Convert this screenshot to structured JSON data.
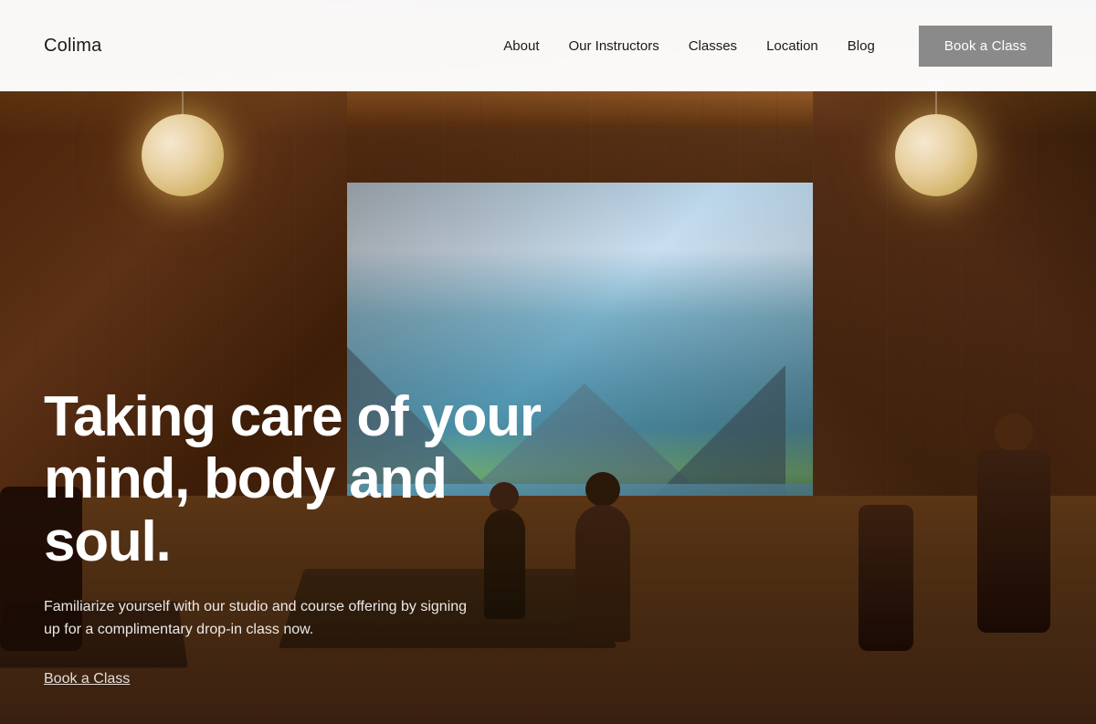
{
  "brand": {
    "logo": "Colima"
  },
  "navbar": {
    "links": [
      {
        "label": "About",
        "id": "about"
      },
      {
        "label": "Our Instructors",
        "id": "instructors"
      },
      {
        "label": "Classes",
        "id": "classes"
      },
      {
        "label": "Location",
        "id": "location"
      },
      {
        "label": "Blog",
        "id": "blog"
      }
    ],
    "cta_label": "Book a Class"
  },
  "hero": {
    "title": "Taking care of your mind, body and soul.",
    "subtitle": "Familiarize yourself with our studio and course offering by signing up for a complimentary drop-in class now.",
    "cta_label": "Book a Class"
  }
}
